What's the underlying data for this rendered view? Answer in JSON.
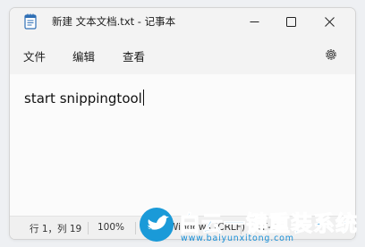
{
  "window": {
    "title": "新建 文本文档.txt - 记事本",
    "app_icon": "notepad-icon",
    "controls": [
      "minimize-icon",
      "maximize-icon",
      "close-icon"
    ]
  },
  "menu": {
    "items": [
      {
        "label": "文件"
      },
      {
        "label": "编辑"
      },
      {
        "label": "查看"
      }
    ],
    "settings_icon": "gear-icon"
  },
  "editor": {
    "content": "start snippingtool"
  },
  "status": {
    "position": "行 1，列 19",
    "zoom": "100%",
    "line_ending": "Windows (CRLF)",
    "encoding": "UTF-8"
  },
  "watermark": {
    "title": "白云一键重装系统",
    "url": "www.baiyunxitong.com"
  },
  "colors": {
    "accent": "#1a8fd6",
    "titlebar": "#f3f3f3",
    "editor_bg": "#fbfbfb"
  }
}
